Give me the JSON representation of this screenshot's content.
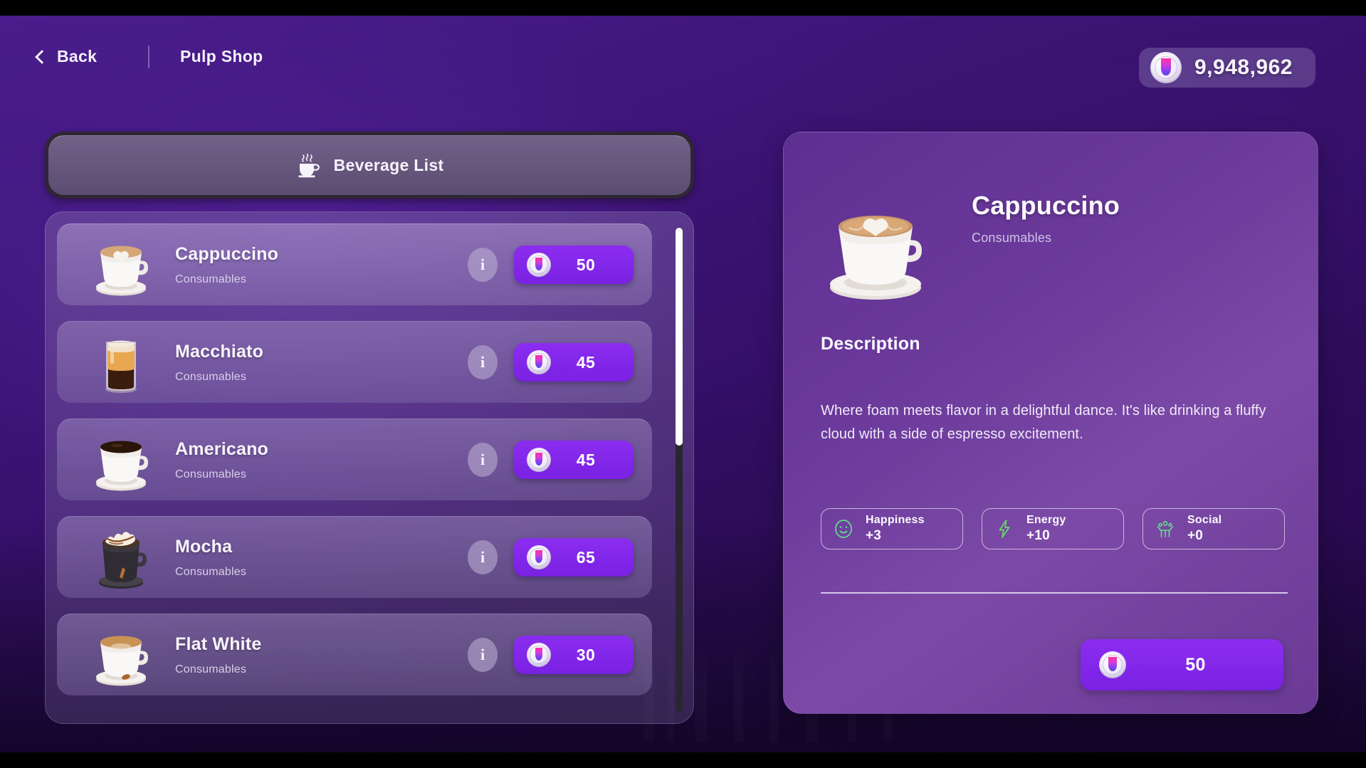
{
  "header": {
    "back_label": "Back",
    "title": "Pulp Shop",
    "back_icon": "chevron-left-icon"
  },
  "currency": {
    "value": "9,948,962",
    "icon": "pulp-coin-icon",
    "coin_gradient": [
      "#ff2fa0",
      "#8a3ff0",
      "#5b47e8"
    ]
  },
  "tab": {
    "label": "Beverage List",
    "icon": "coffee-cup-icon"
  },
  "list": {
    "items": [
      {
        "name": "Cappuccino",
        "category": "Consumables",
        "price": "50",
        "info_label": "i",
        "thumb": "cappuccino-cup-icon",
        "selected": true
      },
      {
        "name": "Macchiato",
        "category": "Consumables",
        "price": "45",
        "info_label": "i",
        "thumb": "macchiato-glass-icon",
        "selected": false
      },
      {
        "name": "Americano",
        "category": "Consumables",
        "price": "45",
        "info_label": "i",
        "thumb": "americano-cup-icon",
        "selected": false
      },
      {
        "name": "Mocha",
        "category": "Consumables",
        "price": "65",
        "info_label": "i",
        "thumb": "mocha-mug-icon",
        "selected": false
      },
      {
        "name": "Flat White",
        "category": "Consumables",
        "price": "30",
        "info_label": "i",
        "thumb": "flat-white-cup-icon",
        "selected": false
      }
    ],
    "scroll_thumb_percent": 45
  },
  "detail": {
    "name": "Cappuccino",
    "category": "Consumables",
    "thumb": "cappuccino-cup-icon",
    "description_heading": "Description",
    "description": "Where foam meets flavor in a delightful dance. It's like drinking a fluffy cloud with a side of espresso excitement.",
    "stats": [
      {
        "label": "Happiness",
        "value": "+3",
        "icon": "smiley-face-icon",
        "color": "#5fe08a"
      },
      {
        "label": "Energy",
        "value": "+10",
        "icon": "lightning-bolt-icon",
        "color": "#5fe060"
      },
      {
        "label": "Social",
        "value": "+0",
        "icon": "person-raised-arms-icon",
        "color": "#5fe08a"
      }
    ],
    "buy_price": "50"
  },
  "theme": {
    "accent_purple": "#7a21e2",
    "panel_purple": "#6b3a9b",
    "background_purple": "#3a1272",
    "stat_green": "#5fe08a"
  }
}
